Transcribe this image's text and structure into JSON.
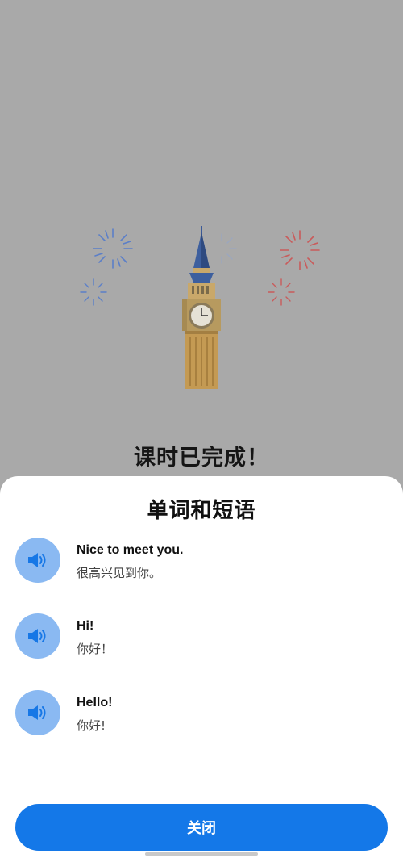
{
  "lesson": {
    "complete_title": "课时已完成！"
  },
  "sheet": {
    "title": "单词和短语",
    "phrases": [
      {
        "en": "Nice to meet you.",
        "zh": "很高兴见到你。"
      },
      {
        "en": "Hi!",
        "zh": "你好！"
      },
      {
        "en": "Hello!",
        "zh": "你好!"
      }
    ],
    "close_label": "关闭"
  },
  "colors": {
    "backdrop": "#a9a9a9",
    "audio_button": "#8ab9f2",
    "speaker_icon": "#1677e6",
    "primary_button": "#1478e8"
  },
  "icons": {
    "audio": "speaker-icon",
    "illustration": "big-ben-illustration",
    "decor": "firework-icon"
  }
}
